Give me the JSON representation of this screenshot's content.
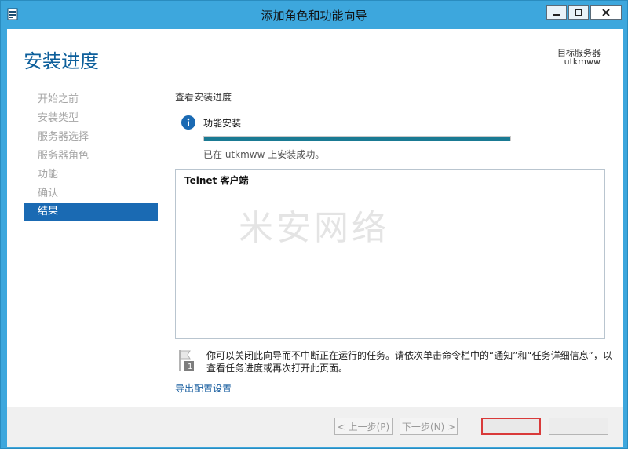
{
  "window": {
    "title": "添加角色和功能向导",
    "controls": {
      "minimize": "—",
      "maximize": "□",
      "close": "✕"
    }
  },
  "header": {
    "page_title": "安装进度",
    "target_server_label": "目标服务器",
    "target_server_name": "utkmww"
  },
  "nav": {
    "items": [
      {
        "label": "开始之前",
        "active": false
      },
      {
        "label": "安装类型",
        "active": false
      },
      {
        "label": "服务器选择",
        "active": false
      },
      {
        "label": "服务器角色",
        "active": false
      },
      {
        "label": "功能",
        "active": false
      },
      {
        "label": "确认",
        "active": false
      },
      {
        "label": "结果",
        "active": true
      }
    ]
  },
  "main": {
    "section_heading": "查看安装进度",
    "status_label": "功能安装",
    "progress_fraction": 1.0,
    "success_message": "已在 utkmww 上安装成功。",
    "results": [
      "Telnet 客户端"
    ],
    "watermark": "米安网络",
    "note_text": "你可以关闭此向导而不中断正在运行的任务。请依次单击命令栏中的“通知”和“任务详细信息”，以查看任务进度或再次打开此页面。",
    "export_link": "导出配置设置"
  },
  "footer": {
    "prev_label": "< 上一步(P)",
    "next_label": "下一步(N) >",
    "install_label": "",
    "cancel_label": ""
  },
  "colors": {
    "titlebar": "#3da7dd",
    "title_accent": "#0d5f9b",
    "nav_active_bg": "#1a6ab3",
    "progress_fill": "#1a7a93",
    "highlight_border": "#d93a3a"
  }
}
